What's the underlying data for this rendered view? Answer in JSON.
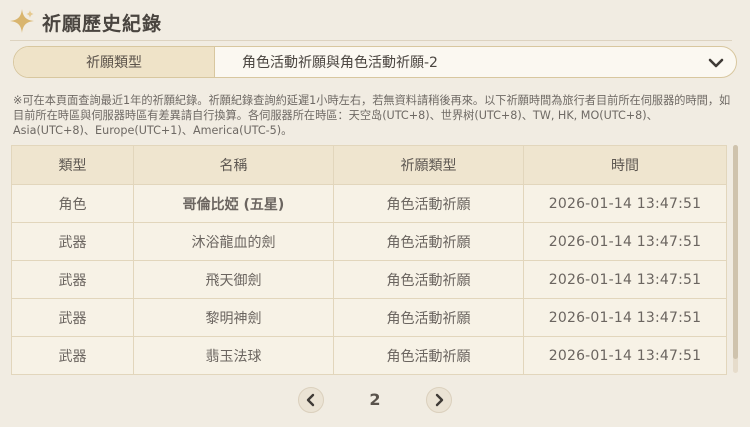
{
  "header": {
    "title": "祈願歷史紀錄"
  },
  "filter": {
    "label": "祈願類型",
    "selected": "角色活動祈願與角色活動祈願-2"
  },
  "notice": "※可在本頁面查詢最近1年的祈願紀錄。祈願紀錄查詢約延遲1小時左右，若無資料請稍後再來。以下祈願時間為旅行者目前所在伺服器的時間，如目前所在時區與伺服器時區有差異請自行換算。各伺服器所在時區：天空岛(UTC+8)、世界树(UTC+8)、TW, HK, MO(UTC+8)、Asia(UTC+8)、Europe(UTC+1)、America(UTC-5)。",
  "table": {
    "headers": [
      "類型",
      "名稱",
      "祈願類型",
      "時間"
    ],
    "rows": [
      {
        "type": "角色",
        "name": "哥倫比婭 (五星)",
        "banner": "角色活動祈願",
        "time": "2026-01-14 13:47:51"
      },
      {
        "type": "武器",
        "name": "沐浴龍血的劍",
        "banner": "角色活動祈願",
        "time": "2026-01-14 13:47:51"
      },
      {
        "type": "武器",
        "name": "飛天御劍",
        "banner": "角色活動祈願",
        "time": "2026-01-14 13:47:51"
      },
      {
        "type": "武器",
        "name": "黎明神劍",
        "banner": "角色活動祈願",
        "time": "2026-01-14 13:47:51"
      },
      {
        "type": "武器",
        "name": "翡玉法球",
        "banner": "角色活動祈願",
        "time": "2026-01-14 13:47:51"
      }
    ]
  },
  "pager": {
    "page": "2"
  },
  "colors": {
    "five_star": "#b9772f",
    "accent": "#d8c79f"
  },
  "icons": {
    "header": "sparkle-star-icon",
    "dropdown": "chevron-down-icon",
    "prev": "chevron-left-icon",
    "next": "chevron-right-icon"
  }
}
